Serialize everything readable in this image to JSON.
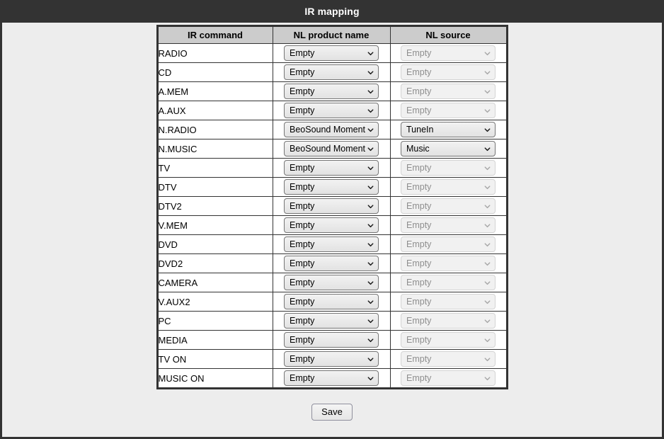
{
  "window": {
    "title": "IR mapping"
  },
  "table": {
    "headers": {
      "command": "IR command",
      "product": "NL product name",
      "source": "NL source"
    },
    "rows": [
      {
        "command": "RADIO",
        "product": "Empty",
        "product_enabled": true,
        "source": "Empty",
        "source_enabled": false
      },
      {
        "command": "CD",
        "product": "Empty",
        "product_enabled": true,
        "source": "Empty",
        "source_enabled": false
      },
      {
        "command": "A.MEM",
        "product": "Empty",
        "product_enabled": true,
        "source": "Empty",
        "source_enabled": false
      },
      {
        "command": "A.AUX",
        "product": "Empty",
        "product_enabled": true,
        "source": "Empty",
        "source_enabled": false
      },
      {
        "command": "N.RADIO",
        "product": "BeoSound Moment",
        "product_enabled": true,
        "source": "TuneIn",
        "source_enabled": true
      },
      {
        "command": "N.MUSIC",
        "product": "BeoSound Moment",
        "product_enabled": true,
        "source": "Music",
        "source_enabled": true
      },
      {
        "command": "TV",
        "product": "Empty",
        "product_enabled": true,
        "source": "Empty",
        "source_enabled": false
      },
      {
        "command": "DTV",
        "product": "Empty",
        "product_enabled": true,
        "source": "Empty",
        "source_enabled": false
      },
      {
        "command": "DTV2",
        "product": "Empty",
        "product_enabled": true,
        "source": "Empty",
        "source_enabled": false
      },
      {
        "command": "V.MEM",
        "product": "Empty",
        "product_enabled": true,
        "source": "Empty",
        "source_enabled": false
      },
      {
        "command": "DVD",
        "product": "Empty",
        "product_enabled": true,
        "source": "Empty",
        "source_enabled": false
      },
      {
        "command": "DVD2",
        "product": "Empty",
        "product_enabled": true,
        "source": "Empty",
        "source_enabled": false
      },
      {
        "command": "CAMERA",
        "product": "Empty",
        "product_enabled": true,
        "source": "Empty",
        "source_enabled": false
      },
      {
        "command": "V.AUX2",
        "product": "Empty",
        "product_enabled": true,
        "source": "Empty",
        "source_enabled": false
      },
      {
        "command": "PC",
        "product": "Empty",
        "product_enabled": true,
        "source": "Empty",
        "source_enabled": false
      },
      {
        "command": "MEDIA",
        "product": "Empty",
        "product_enabled": true,
        "source": "Empty",
        "source_enabled": false
      },
      {
        "command": "TV ON",
        "product": "Empty",
        "product_enabled": true,
        "source": "Empty",
        "source_enabled": false
      },
      {
        "command": "MUSIC ON",
        "product": "Empty",
        "product_enabled": true,
        "source": "Empty",
        "source_enabled": false
      }
    ]
  },
  "actions": {
    "save_label": "Save"
  },
  "colors": {
    "title_bar": "#333333",
    "page_background": "#ededed",
    "table_header": "#cccccc",
    "border": "#333333"
  }
}
